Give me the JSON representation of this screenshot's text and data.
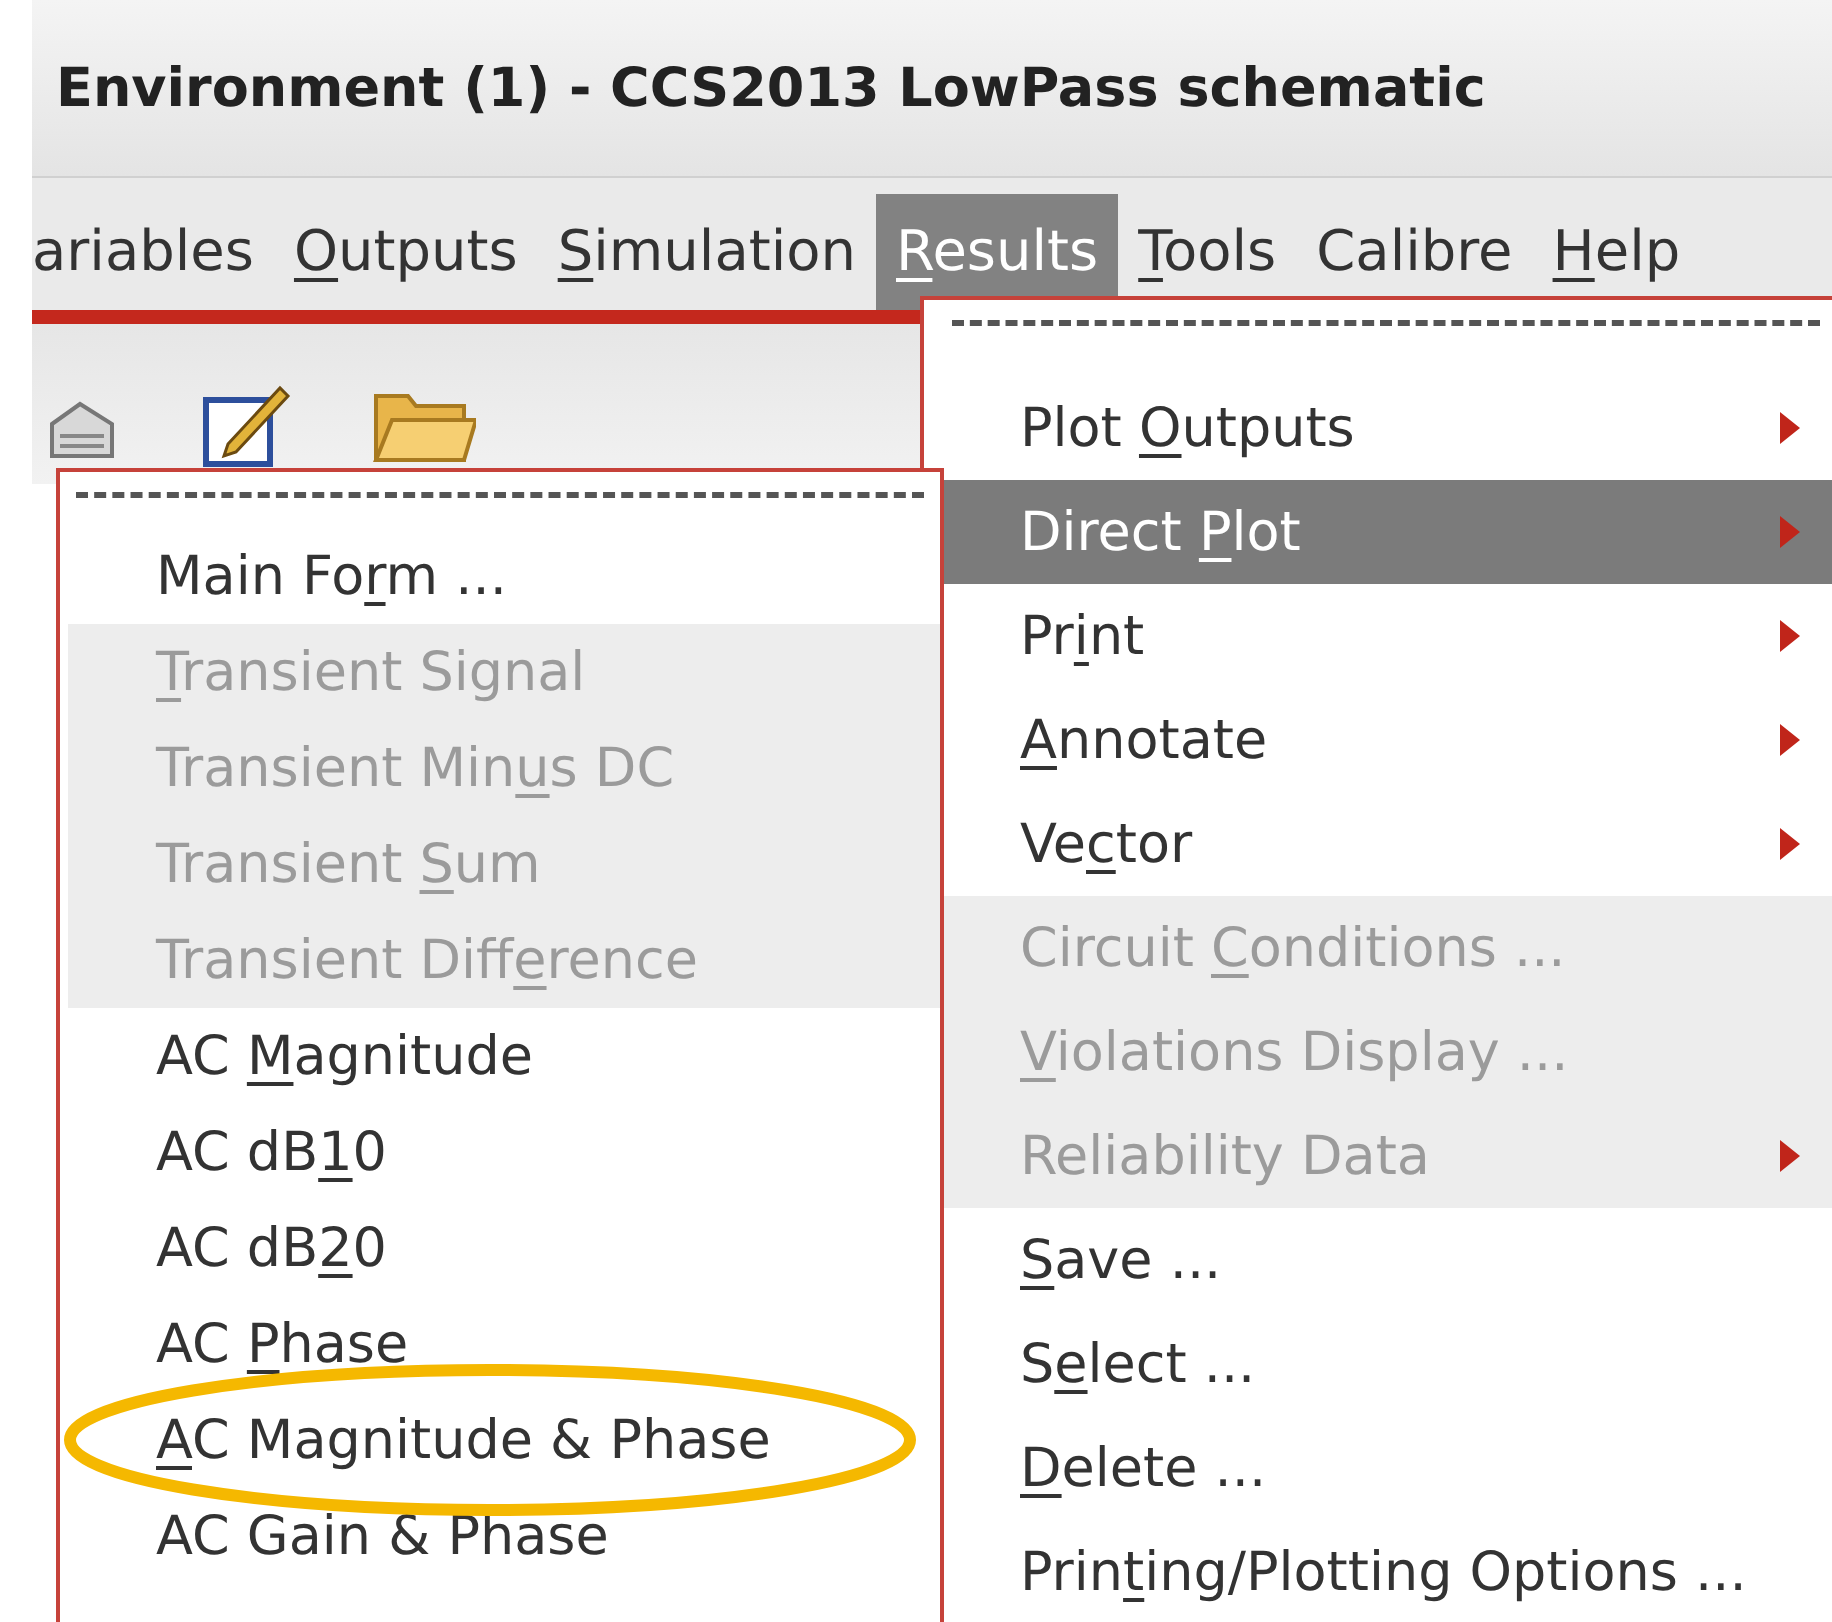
{
  "window": {
    "title": "Environment (1) - CCS2013 LowPass schematic"
  },
  "menubar": [
    {
      "label": {
        "post": "ariables"
      },
      "selected": false
    },
    {
      "label": {
        "key": "O",
        "post": "utputs"
      },
      "selected": false
    },
    {
      "label": {
        "key": "S",
        "post": "imulation"
      },
      "selected": false
    },
    {
      "label": {
        "key": "R",
        "post": "esults"
      },
      "selected": true
    },
    {
      "label": {
        "key": "T",
        "post": "ools"
      },
      "selected": false
    },
    {
      "label": {
        "post": "Calibre"
      },
      "selected": false
    },
    {
      "label": {
        "key": "H",
        "post": "elp"
      },
      "selected": false
    }
  ],
  "results_menu": [
    {
      "label": {
        "pre": "Plot ",
        "key": "O",
        "post": "utputs"
      },
      "submenu": true,
      "disabled": false,
      "selected": false
    },
    {
      "label": {
        "pre": "Direct ",
        "key": "P",
        "post": "lot"
      },
      "submenu": true,
      "disabled": false,
      "selected": true
    },
    {
      "label": {
        "pre": "Pr",
        "key": "i",
        "post": "nt"
      },
      "submenu": true,
      "disabled": false,
      "selected": false
    },
    {
      "label": {
        "key": "A",
        "post": "nnotate"
      },
      "submenu": true,
      "disabled": false,
      "selected": false
    },
    {
      "label": {
        "pre": "Ve",
        "key": "c",
        "post": "tor"
      },
      "submenu": true,
      "disabled": false,
      "selected": false
    },
    {
      "label": {
        "pre": "Circuit ",
        "key": "C",
        "post": "onditions ..."
      },
      "submenu": false,
      "disabled": true,
      "selected": false
    },
    {
      "label": {
        "key": "V",
        "post": "iolations Display ..."
      },
      "submenu": false,
      "disabled": true,
      "selected": false
    },
    {
      "label": {
        "post": "Reliability Data"
      },
      "submenu": true,
      "disabled": true,
      "selected": false
    },
    {
      "label": {
        "key": "S",
        "post": "ave ..."
      },
      "submenu": false,
      "disabled": false,
      "selected": false
    },
    {
      "label": {
        "pre": "S",
        "key": "e",
        "post": "lect ..."
      },
      "submenu": false,
      "disabled": false,
      "selected": false
    },
    {
      "label": {
        "key": "D",
        "post": "elete ..."
      },
      "submenu": false,
      "disabled": false,
      "selected": false
    },
    {
      "label": {
        "pre": "Prin",
        "key": "t",
        "post": "ing/Plotting Options ..."
      },
      "submenu": false,
      "disabled": false,
      "selected": false
    }
  ],
  "direct_plot_menu": [
    {
      "label": {
        "pre": "Main Fo",
        "key": "r",
        "post": "m ..."
      },
      "disabled": false,
      "circled": false
    },
    {
      "label": {
        "key": "T",
        "post": "ransient Signal"
      },
      "disabled": true,
      "circled": false
    },
    {
      "label": {
        "pre": "Transient Min",
        "key": "u",
        "post": "s DC"
      },
      "disabled": true,
      "circled": false
    },
    {
      "label": {
        "pre": "Transient ",
        "key": "S",
        "post": "um"
      },
      "disabled": true,
      "circled": false
    },
    {
      "label": {
        "pre": "Transient Diff",
        "key": "e",
        "post": "rence"
      },
      "disabled": true,
      "circled": false
    },
    {
      "label": {
        "pre": "AC ",
        "key": "M",
        "post": "agnitude"
      },
      "disabled": false,
      "circled": false
    },
    {
      "label": {
        "pre": "AC dB",
        "key": "1",
        "post": "0"
      },
      "disabled": false,
      "circled": false
    },
    {
      "label": {
        "pre": "AC dB",
        "key": "2",
        "post": "0"
      },
      "disabled": false,
      "circled": false
    },
    {
      "label": {
        "pre": "AC ",
        "key": "P",
        "post": "hase"
      },
      "disabled": false,
      "circled": false
    },
    {
      "label": {
        "key": "A",
        "post": "C Magnitude & Phase"
      },
      "disabled": false,
      "circled": true
    },
    {
      "label": {
        "post": "AC Gain & Phase"
      },
      "disabled": false,
      "circled": false
    }
  ]
}
